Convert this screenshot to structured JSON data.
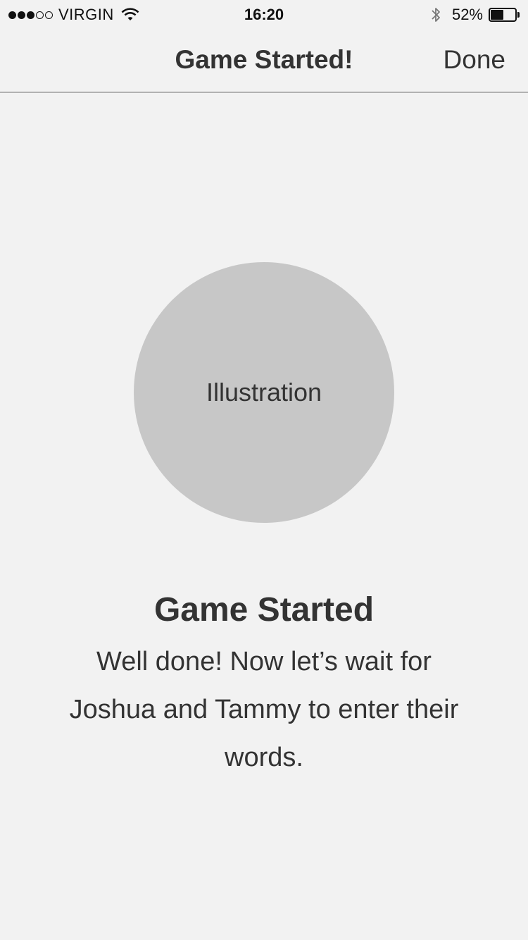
{
  "status_bar": {
    "carrier": "VIRGIN",
    "time": "16:20",
    "battery_percent": "52%",
    "battery_level": 0.52,
    "signal_bars_filled": 3,
    "signal_bars_total": 5
  },
  "nav": {
    "title": "Game Started!",
    "done_label": "Done"
  },
  "illustration": {
    "label": "Illustration"
  },
  "message": {
    "title": "Game Started",
    "body": "Well done! Now let’s wait for Joshua and Tammy to enter their words."
  },
  "colors": {
    "background": "#f2f2f2",
    "text": "#333333",
    "placeholder": "#c7c7c7",
    "divider": "#b2b2b2"
  }
}
